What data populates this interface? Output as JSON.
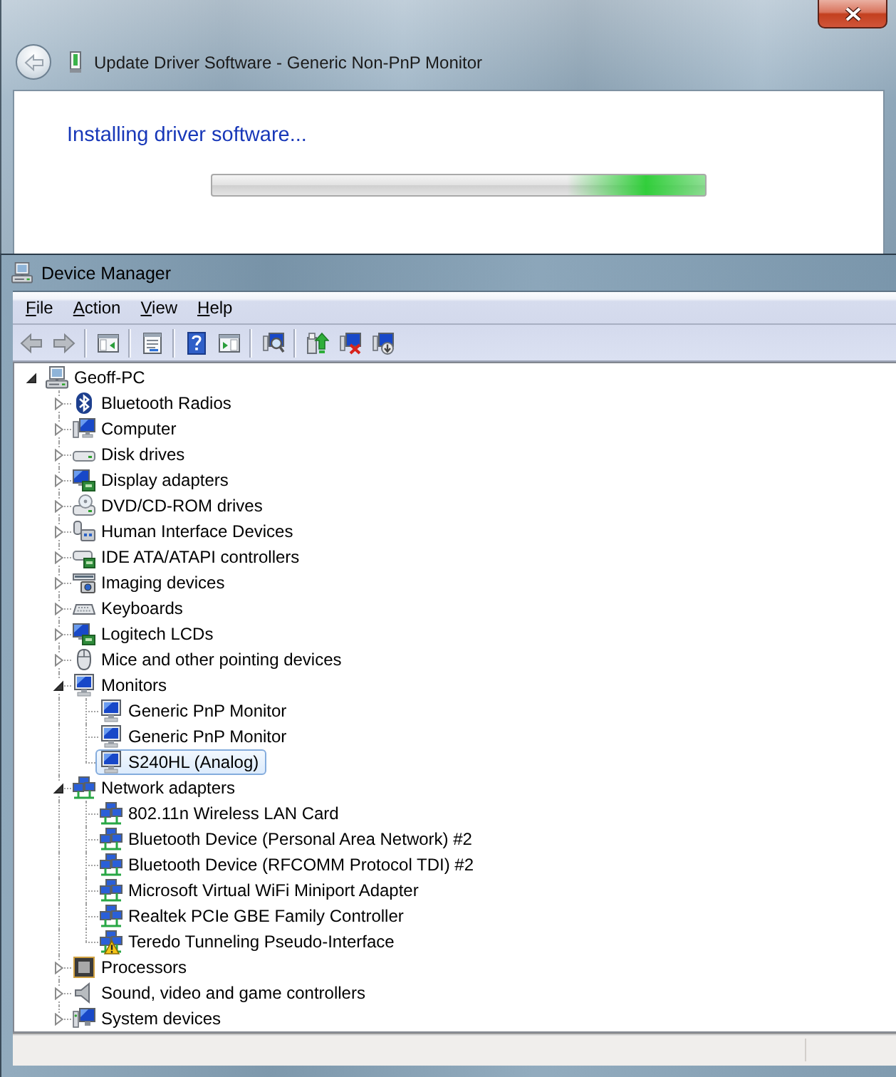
{
  "update_dialog": {
    "title": "Update Driver Software - Generic Non-PnP Monitor",
    "back_button": {
      "disabled": true
    },
    "heading": "Installing driver software...",
    "progress_bar": {
      "on": true
    }
  },
  "device_manager": {
    "title": "Device Manager",
    "menu": [
      {
        "label": "File"
      },
      {
        "label": "Action"
      },
      {
        "label": "View"
      },
      {
        "label": "Help"
      }
    ],
    "toolbar": {
      "back": {
        "disabled": true
      },
      "forward": {
        "disabled": true
      }
    },
    "tree": [
      {
        "label": "Geoff-PC",
        "kind": "root",
        "expanded": true,
        "selected": false,
        "children": [
          {
            "label": "Bluetooth Radios",
            "kind": "bluetooth",
            "expanded": false,
            "selected": false
          },
          {
            "label": "Computer",
            "kind": "computer",
            "expanded": false,
            "selected": false
          },
          {
            "label": "Disk drives",
            "kind": "disk",
            "expanded": false,
            "selected": false
          },
          {
            "label": "Display adapters",
            "kind": "display",
            "expanded": false,
            "selected": false
          },
          {
            "label": "DVD/CD-ROM drives",
            "kind": "optical",
            "expanded": false,
            "selected": false
          },
          {
            "label": "Human Interface Devices",
            "kind": "hid",
            "expanded": false,
            "selected": false
          },
          {
            "label": "IDE ATA/ATAPI controllers",
            "kind": "ide",
            "expanded": false,
            "selected": false
          },
          {
            "label": "Imaging devices",
            "kind": "imaging",
            "expanded": false,
            "selected": false
          },
          {
            "label": "Keyboards",
            "kind": "keyboard",
            "expanded": false,
            "selected": false
          },
          {
            "label": "Logitech LCDs",
            "kind": "display",
            "expanded": false,
            "selected": false
          },
          {
            "label": "Mice and other pointing devices",
            "kind": "mouse",
            "expanded": false,
            "selected": false
          },
          {
            "label": "Monitors",
            "kind": "monitor",
            "expanded": true,
            "selected": false,
            "children": [
              {
                "label": "Generic PnP Monitor",
                "kind": "monitor",
                "selected": false
              },
              {
                "label": "Generic PnP Monitor",
                "kind": "monitor",
                "selected": false
              },
              {
                "label": "S240HL (Analog)",
                "kind": "monitor",
                "selected": true
              }
            ]
          },
          {
            "label": "Network adapters",
            "kind": "network",
            "expanded": true,
            "selected": false,
            "children": [
              {
                "label": "802.11n Wireless LAN Card",
                "kind": "network",
                "selected": false,
                "warning": false
              },
              {
                "label": "Bluetooth Device (Personal Area Network) #2",
                "kind": "network",
                "selected": false,
                "warning": false
              },
              {
                "label": "Bluetooth Device (RFCOMM Protocol TDI) #2",
                "kind": "network",
                "selected": false,
                "warning": false
              },
              {
                "label": "Microsoft Virtual WiFi Miniport Adapter",
                "kind": "network",
                "selected": false,
                "warning": false
              },
              {
                "label": "Realtek PCIe GBE Family Controller",
                "kind": "network",
                "selected": false,
                "warning": false
              },
              {
                "label": "Teredo Tunneling Pseudo-Interface",
                "kind": "network",
                "selected": false,
                "warning": true
              }
            ]
          },
          {
            "label": "Processors",
            "kind": "processor",
            "expanded": false,
            "selected": false
          },
          {
            "label": "Sound, video and game controllers",
            "kind": "sound",
            "expanded": false,
            "selected": false
          },
          {
            "label": "System devices",
            "kind": "system",
            "expanded": false,
            "selected": false
          }
        ]
      }
    ]
  }
}
